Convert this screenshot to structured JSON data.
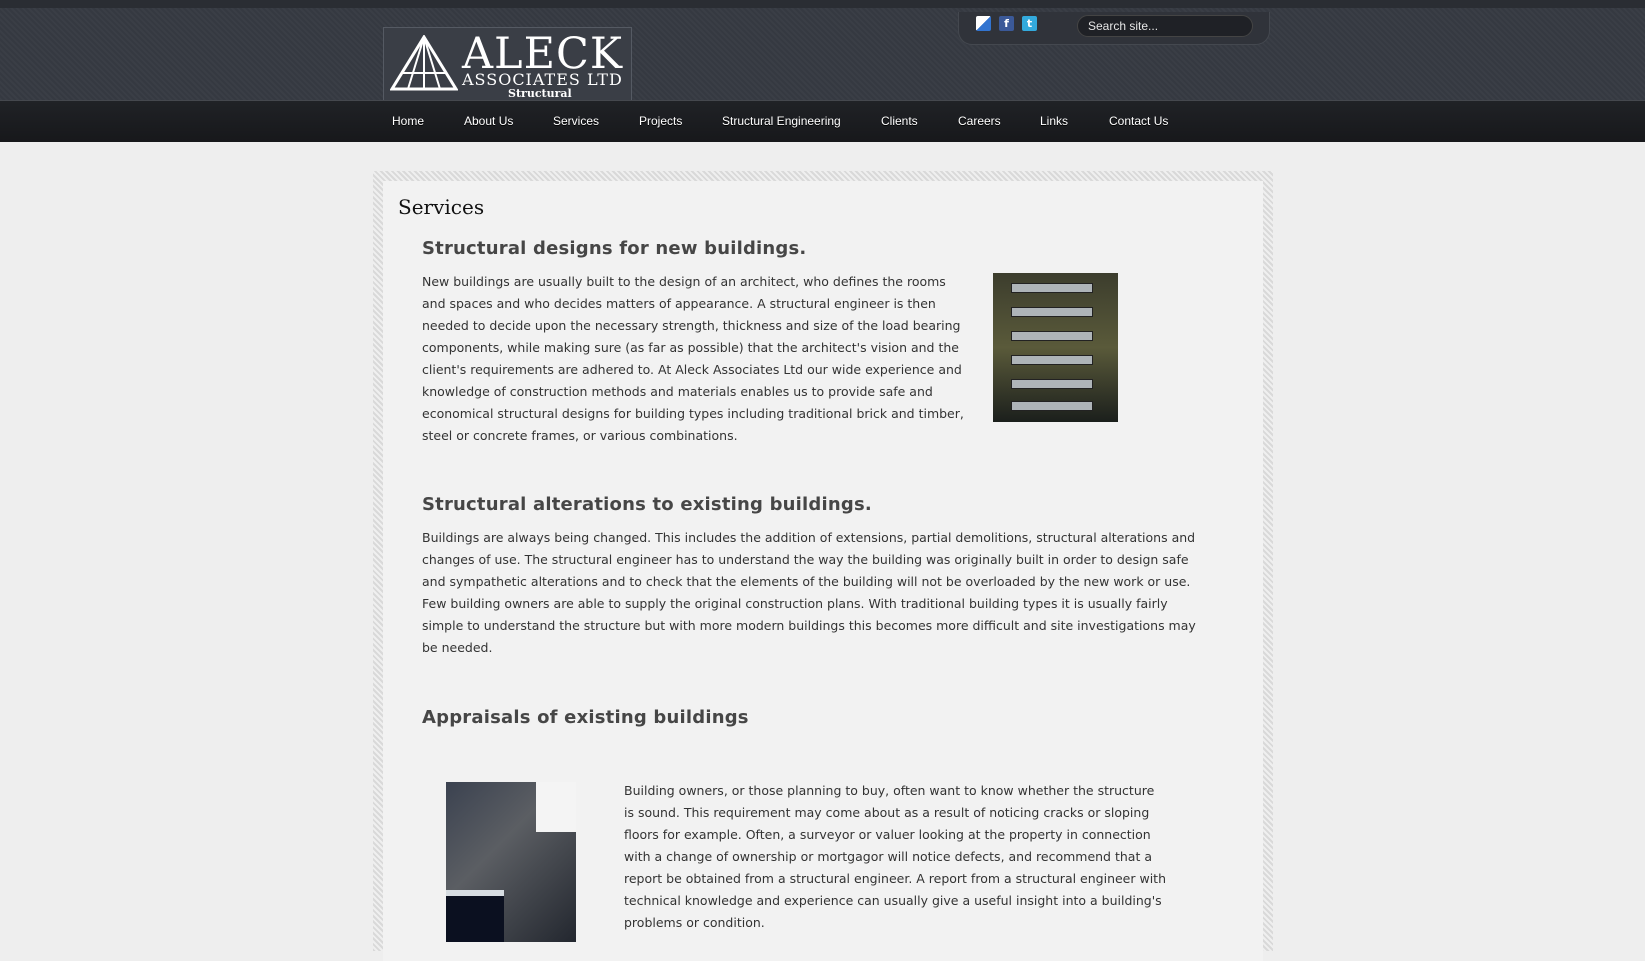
{
  "header": {
    "logo": {
      "name": "ALECK",
      "subtitle": "ASSOCIATES LTD",
      "tagline": "Structural Engineers"
    },
    "social_icons": [
      "delicious-icon",
      "facebook-icon",
      "twitter-icon"
    ],
    "search": {
      "placeholder": "Search site..."
    }
  },
  "nav": {
    "items": [
      {
        "label": "Home"
      },
      {
        "label": "About Us"
      },
      {
        "label": "Services"
      },
      {
        "label": "Projects"
      },
      {
        "label": "Structural Engineering"
      },
      {
        "label": "Clients"
      },
      {
        "label": "Careers"
      },
      {
        "label": "Links"
      },
      {
        "label": "Contact Us"
      }
    ]
  },
  "main": {
    "title": "Services",
    "sections": [
      {
        "heading": "Structural designs for new buildings.",
        "lines": [
          "New buildings are usually built to the design of an architect, who defines the rooms",
          "and spaces and who decides matters of appearance. A structural engineer is then",
          "needed to decide upon the necessary strength, thickness and size of the load bearing",
          "components, while making sure (as far as possible) that the architect's vision and the",
          "client's requirements are adhered to. At Aleck Associates Ltd our wide experience and",
          "knowledge of construction methods and materials enables us to provide safe and",
          "economical structural designs for building types including traditional brick and timber,",
          "steel or concrete frames, or various combinations."
        ]
      },
      {
        "heading": "Structural alterations to existing buildings.",
        "lines": [
          "Buildings are always being changed. This includes the addition of extensions, partial demolitions, structural alterations and",
          "changes of use. The structural engineer has to understand the way the building was originally built in order to design safe",
          "and sympathetic alterations and to check that the elements of the building will not be overloaded by the new work or use.",
          "Few building owners are able to supply the original construction plans. With traditional building types it is usually fairly",
          "simple to understand the structure but with more modern buildings this becomes more difficult and site investigations may",
          "be needed."
        ]
      },
      {
        "heading": "Appraisals of existing buildings",
        "lines": [
          "Building owners, or those planning to buy, often want to know whether the structure",
          "is sound. This requirement may come about as a result of noticing cracks or sloping",
          "floors for example. Often, a surveyor or valuer looking at the property in connection",
          "with a change of ownership or mortgagor will notice defects, and recommend that a",
          "report be obtained from a structural engineer. A report from a structural engineer with",
          "technical knowledge and experience can usually give a useful insight into a building's",
          "problems or condition."
        ]
      }
    ]
  }
}
